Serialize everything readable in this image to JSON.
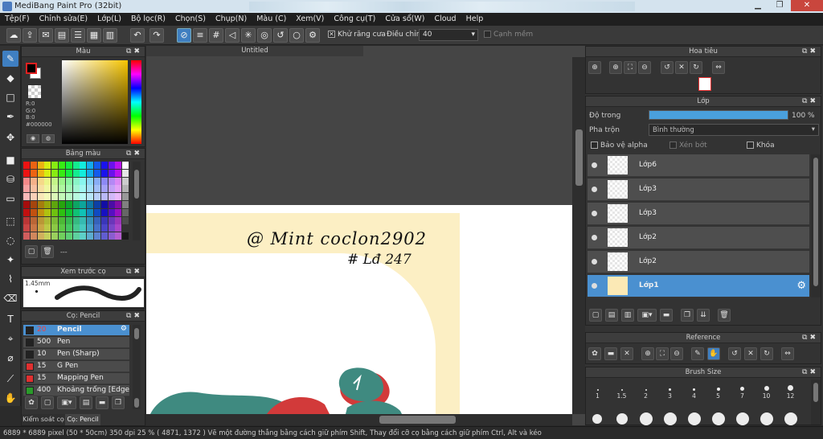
{
  "window": {
    "title": "MediBang Paint Pro (32bit)",
    "minimize": "▁",
    "maximize": "❐",
    "close": "✕"
  },
  "menu": [
    "Tệp(F)",
    "Chỉnh sửa(E)",
    "Lớp(L)",
    "Bộ lọc(R)",
    "Chọn(S)",
    "Chụp(N)",
    "Màu (C)",
    "Xem(V)",
    "Công cụ(T)",
    "Cửa sổ(W)",
    "Cloud",
    "Help"
  ],
  "toolbar": {
    "antialias_label": "Khử răng cưa",
    "antialias_checked": "✕",
    "adjust_label": "Điều chỉnh",
    "adjust_value": "40",
    "smooth_label": "Cạnh mềm"
  },
  "color_panel": {
    "title": "Màu",
    "r": "R:0",
    "g": "G:0",
    "b": "B:0",
    "hex": "#000000",
    "primary": "#000000",
    "secondary": "#ffffff"
  },
  "palette_panel": {
    "title": "Bảng màu",
    "name": "---"
  },
  "preview_panel": {
    "title": "Xem trước cọ",
    "size": "1.45mm"
  },
  "brush_panel": {
    "title": "Cọ: Pencil",
    "items": [
      {
        "size": "20",
        "name": "Pencil",
        "color": "#222222"
      },
      {
        "size": "500",
        "name": "Pen",
        "color": "#222222"
      },
      {
        "size": "10",
        "name": "Pen (Sharp)",
        "color": "#222222"
      },
      {
        "size": "15",
        "name": "G Pen",
        "color": "#e03030"
      },
      {
        "size": "15",
        "name": "Mapping Pen",
        "color": "#e03030"
      },
      {
        "size": "400",
        "name": "Khoảng trống [Edge Pe",
        "color": "#2a9a2a"
      }
    ],
    "tabs": [
      "Kiểm soát cọ",
      "Cọ: Pencil"
    ]
  },
  "document": {
    "tab": "Untitled",
    "watermark_line1": "@ Mint coclon2902",
    "watermark_line2": "# Lđ 247"
  },
  "navigator": {
    "title": "Hoa tiêu"
  },
  "layer_panel": {
    "title": "Lớp",
    "opacity_label": "Độ trong",
    "opacity_value": "100 %",
    "opacity_fraction": 1.0,
    "blend_label": "Pha trộn",
    "blend_value": "Bình thường",
    "protect_alpha": "Bảo vệ alpha",
    "clip": "Xén bớt",
    "lock": "Khóa",
    "layers": [
      "Lớp6",
      "Lớp3",
      "Lớp3",
      "Lớp2",
      "Lớp2",
      "Lớp1"
    ]
  },
  "reference_panel": {
    "title": "Reference"
  },
  "brush_size_panel": {
    "title": "Brush Size",
    "sizes": [
      "1",
      "1.5",
      "2",
      "3",
      "4",
      "5",
      "7",
      "10",
      "12"
    ]
  },
  "status": {
    "text": "6889 * 6889 pixel   (50 * 50cm)   350 dpi   25 %   ( 4871, 1372 )   Vẽ một đường thẳng bằng cách giữ phím Shift, Thay đổi cỡ cọ bằng cách giữ phím Ctrl, Alt và kéo"
  }
}
